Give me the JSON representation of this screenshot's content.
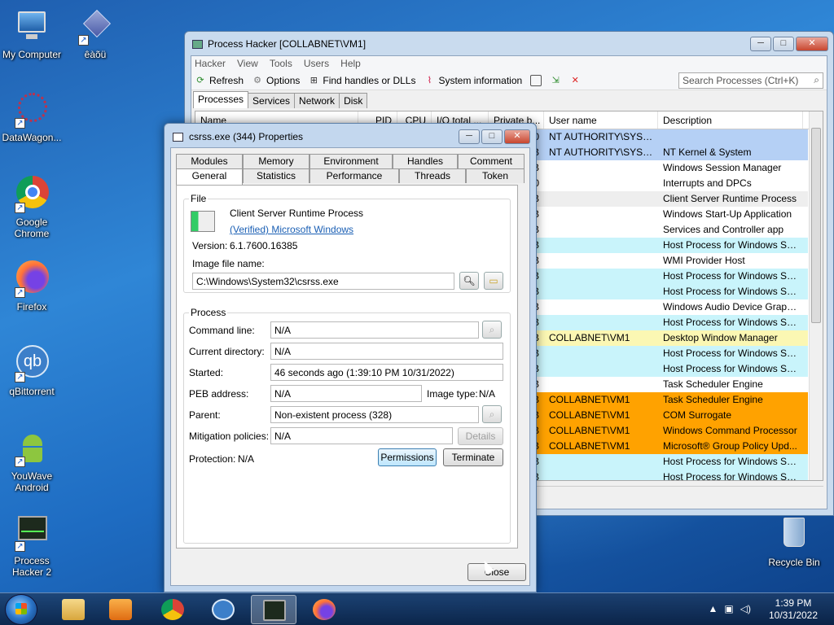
{
  "desktop": {
    "icons": [
      {
        "label": "My Computer"
      },
      {
        "label": "êàõü"
      },
      {
        "label": "DataWagon..."
      },
      {
        "label": "Google Chrome"
      },
      {
        "label": "Firefox"
      },
      {
        "label": "qBittorrent"
      },
      {
        "label": "YouWave Android"
      },
      {
        "label": "Process Hacker 2"
      },
      {
        "label": "Recycle Bin"
      }
    ]
  },
  "ph_window": {
    "title": "Process Hacker [COLLABNET\\VM1]",
    "menu": [
      "Hacker",
      "View",
      "Tools",
      "Users",
      "Help"
    ],
    "toolbar": {
      "refresh": "Refresh",
      "options": "Options",
      "find_handles": "Find handles or DLLs",
      "system_info": "System information"
    },
    "search_placeholder": "Search Processes (Ctrl+K)",
    "tabs": [
      "Processes",
      "Services",
      "Network",
      "Disk"
    ],
    "columns": [
      "Name",
      "PID",
      "CPU",
      "I/O total ...",
      "Private b...",
      "User name",
      "Description"
    ],
    "rows": [
      {
        "frag": "0",
        "user": "NT AUTHORITY\\SYSTEM",
        "desc": "",
        "color": "blue"
      },
      {
        "frag": "B",
        "user": "NT AUTHORITY\\SYSTEM",
        "desc": "NT Kernel & System",
        "color": "blue"
      },
      {
        "frag": "B",
        "user": "",
        "desc": "Windows Session Manager",
        "color": "white"
      },
      {
        "frag": "0",
        "user": "",
        "desc": "Interrupts and DPCs",
        "color": "white"
      },
      {
        "frag": "B",
        "user": "",
        "desc": "Client Server Runtime Process",
        "color": "gray"
      },
      {
        "frag": "B",
        "user": "",
        "desc": "Windows Start-Up Application",
        "color": "white"
      },
      {
        "frag": "B",
        "user": "",
        "desc": "Services and Controller app",
        "color": "white"
      },
      {
        "frag": "B",
        "user": "",
        "desc": "Host Process for Windows Ser...",
        "color": "cyan"
      },
      {
        "frag": "B",
        "user": "",
        "desc": "WMI Provider Host",
        "color": "white"
      },
      {
        "frag": "B",
        "user": "",
        "desc": "Host Process for Windows Ser...",
        "color": "cyan"
      },
      {
        "frag": "B",
        "user": "",
        "desc": "Host Process for Windows Ser...",
        "color": "cyan"
      },
      {
        "frag": "B",
        "user": "",
        "desc": "Windows Audio Device Graph...",
        "color": "white"
      },
      {
        "frag": "B",
        "user": "",
        "desc": "Host Process for Windows Ser...",
        "color": "cyan"
      },
      {
        "frag": "B",
        "user": "COLLABNET\\VM1",
        "desc": "Desktop Window Manager",
        "color": "yellow"
      },
      {
        "frag": "B",
        "user": "",
        "desc": "Host Process for Windows Ser...",
        "color": "cyan"
      },
      {
        "frag": "B",
        "user": "",
        "desc": "Host Process for Windows Ser...",
        "color": "cyan"
      },
      {
        "frag": "B",
        "user": "",
        "desc": "Task Scheduler Engine",
        "color": "white"
      },
      {
        "frag": "B",
        "user": "COLLABNET\\VM1",
        "desc": "Task Scheduler Engine",
        "color": "orange"
      },
      {
        "frag": "B",
        "user": "COLLABNET\\VM1",
        "desc": "COM Surrogate",
        "color": "orange"
      },
      {
        "frag": "B",
        "user": "COLLABNET\\VM1",
        "desc": "Windows Command Processor",
        "color": "orange"
      },
      {
        "frag": "B",
        "user": "COLLABNET\\VM1",
        "desc": "Microsoft® Group Policy Upd...",
        "color": "orange"
      },
      {
        "frag": "B",
        "user": "",
        "desc": "Host Process for Windows Ser...",
        "color": "cyan"
      },
      {
        "frag": "B",
        "user": "",
        "desc": "Host Process for Windows Ser...",
        "color": "cyan"
      }
    ]
  },
  "dialog": {
    "title": "csrss.exe (344) Properties",
    "tabs_top": [
      "Modules",
      "Memory",
      "Environment",
      "Handles",
      "Comment"
    ],
    "tabs_bottom": [
      "General",
      "Statistics",
      "Performance",
      "Threads",
      "Token"
    ],
    "file": {
      "group_label": "File",
      "name": "Client Server Runtime Process",
      "verified": "(Verified) Microsoft Windows",
      "version_label": "Version:",
      "version": "6.1.7600.16385",
      "image_label": "Image file name:",
      "image_path": "C:\\Windows\\System32\\csrss.exe"
    },
    "process": {
      "group_label": "Process",
      "cmdline_label": "Command line:",
      "cmdline": "N/A",
      "curdir_label": "Current directory:",
      "curdir": "N/A",
      "started_label": "Started:",
      "started": "46 seconds ago (1:39:10 PM 10/31/2022)",
      "peb_label": "PEB address:",
      "peb": "N/A",
      "image_type_label": "Image type:",
      "image_type": "N/A",
      "parent_label": "Parent:",
      "parent": "Non-existent process (328)",
      "mitigation_label": "Mitigation policies:",
      "mitigation": "N/A",
      "details": "Details",
      "protection_label": "Protection:",
      "protection": "N/A",
      "permissions": "Permissions",
      "terminate": "Terminate"
    },
    "close": "Close"
  },
  "tray": {
    "time": "1:39 PM",
    "date": "10/31/2022"
  },
  "colors": {
    "row_blue": "#b5d0f5",
    "row_cyan": "#c9f4fb",
    "row_yellow": "#fbf7b3",
    "row_orange": "#ffa200"
  }
}
